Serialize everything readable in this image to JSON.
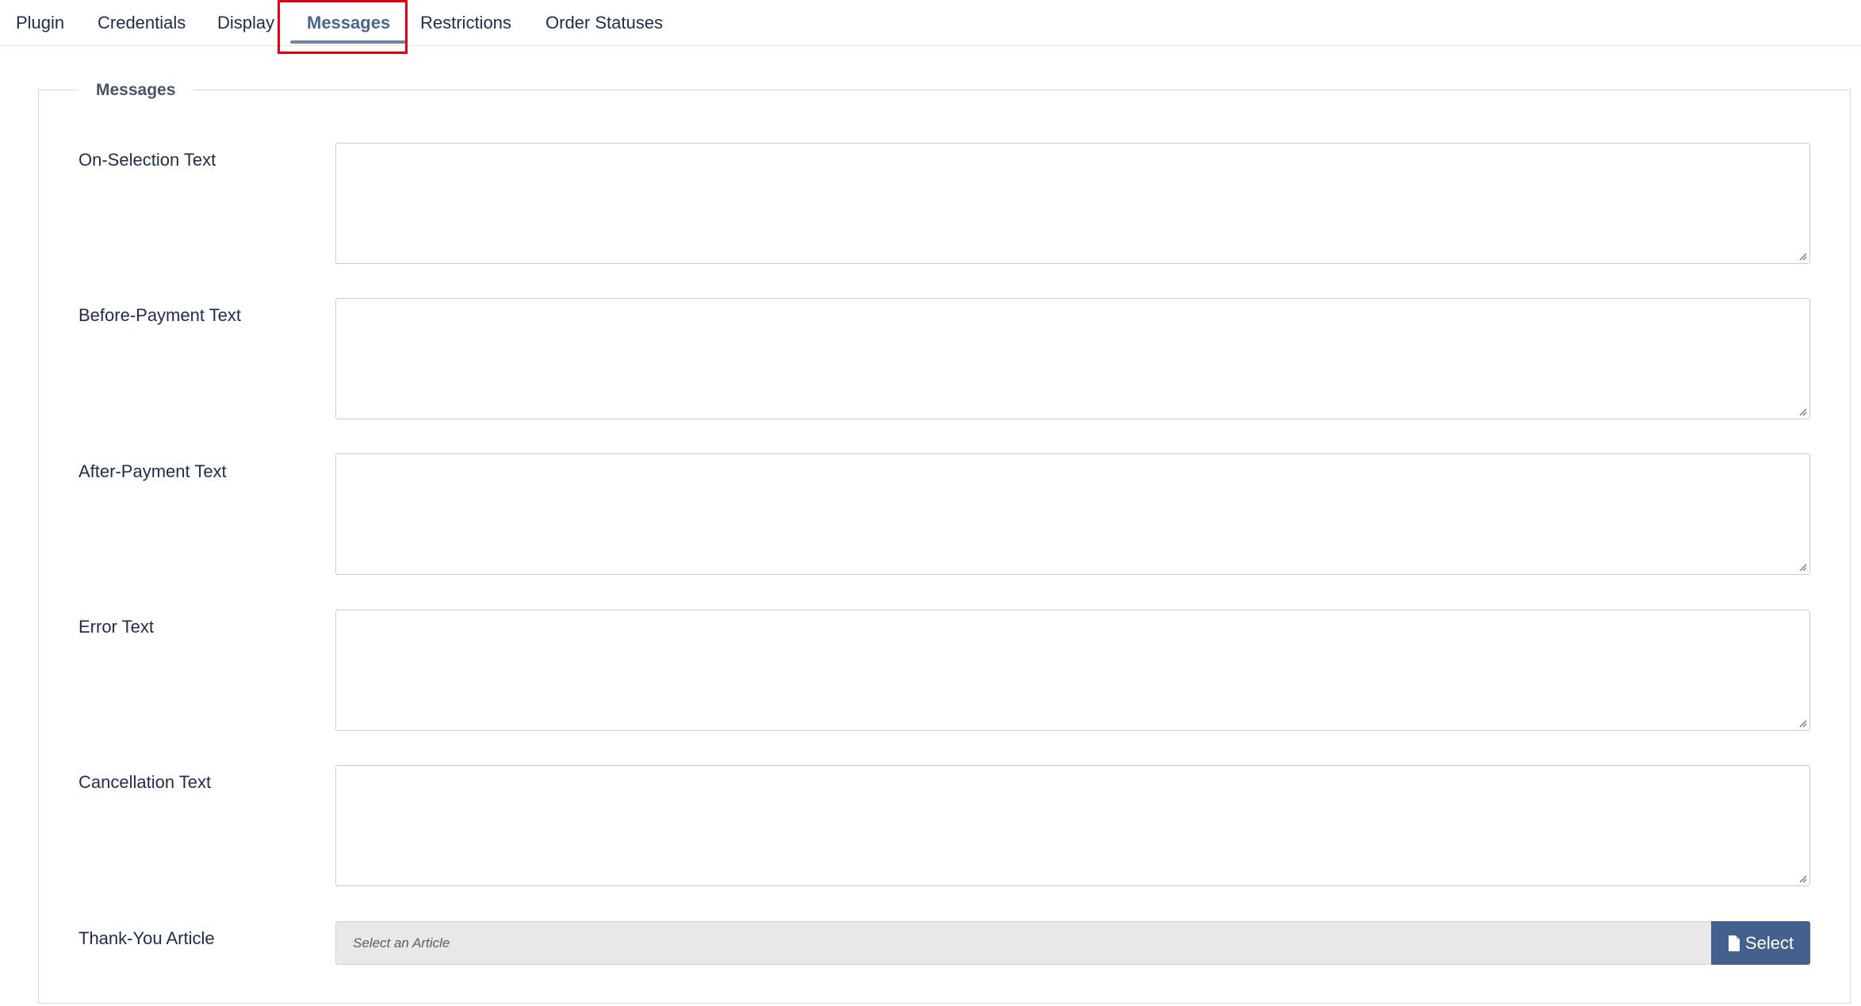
{
  "tabs": [
    {
      "label": "Plugin",
      "active": false
    },
    {
      "label": "Credentials",
      "active": false
    },
    {
      "label": "Display",
      "active": false
    },
    {
      "label": "Messages",
      "active": true
    },
    {
      "label": "Restrictions",
      "active": false
    },
    {
      "label": "Order Statuses",
      "active": false
    }
  ],
  "fieldset": {
    "legend": "Messages",
    "fields": [
      {
        "label": "On-Selection Text",
        "value": ""
      },
      {
        "label": "Before-Payment Text",
        "value": ""
      },
      {
        "label": "After-Payment Text",
        "value": ""
      },
      {
        "label": "Error Text",
        "value": ""
      },
      {
        "label": "Cancellation Text",
        "value": ""
      }
    ],
    "article": {
      "label": "Thank-You Article",
      "placeholder": "Select an Article",
      "value": "",
      "button_label": "Select",
      "button_icon": "file-icon"
    }
  },
  "colors": {
    "accent": "#44618d",
    "active_tab": "#4a6590",
    "highlight": "#e00012"
  }
}
